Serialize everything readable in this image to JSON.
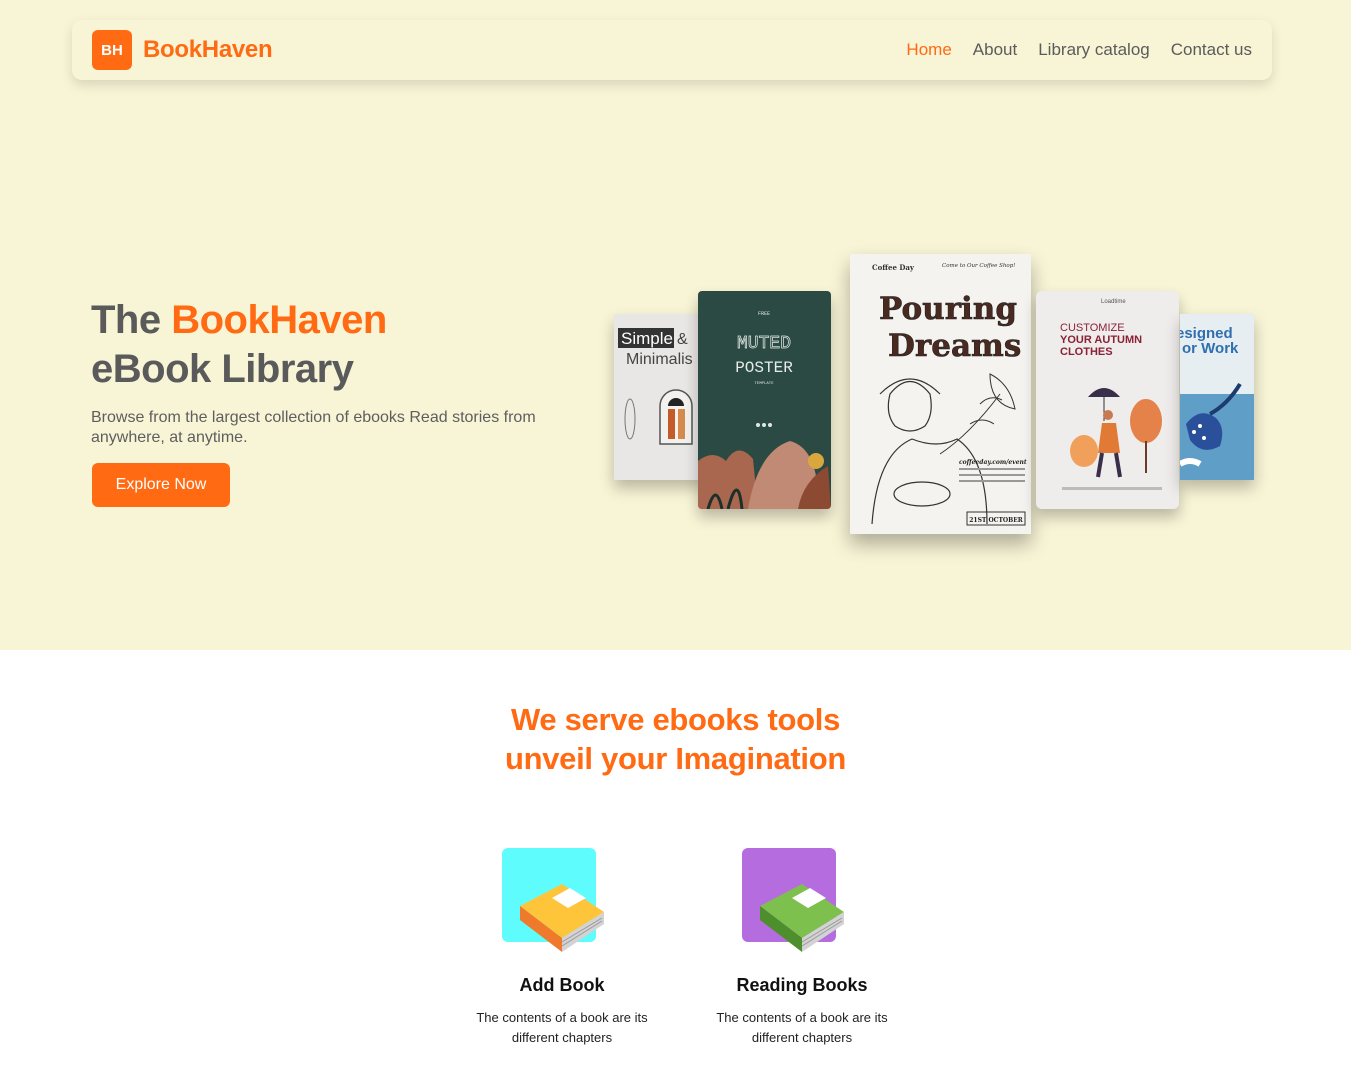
{
  "header": {
    "logo_text": "BH",
    "brand": "BookHaven",
    "nav": [
      {
        "label": "Home",
        "active": true
      },
      {
        "label": "About",
        "active": false
      },
      {
        "label": "Library catalog",
        "active": false
      },
      {
        "label": "Contact us",
        "active": false
      }
    ]
  },
  "hero": {
    "title_prefix": "The ",
    "title_accent": "BookHaven",
    "title_suffix": "eBook Library",
    "description": "Browse from the largest collection of ebooks Read stories from anywhere, at anytime.",
    "cta_label": "Explore Now",
    "covers": [
      {
        "line1": "Simple",
        "line2": "&",
        "line3": "Minimalis"
      },
      {
        "line1": "FREE",
        "line2": "MUTED",
        "line3": "POSTER",
        "line4": "TEMPLATE"
      },
      {
        "line1": "Coffee Day",
        "line2": "Come to Our Coffee Shop!",
        "line3": "Pouring",
        "line4": "Dreams",
        "line5": "coffeeday.com/event",
        "line6": "21ST OCTOBER"
      },
      {
        "line1": "Loadtime",
        "line2": "CUSTOMIZE",
        "line3": "YOUR AUTUMN",
        "line4": "CLOTHES"
      },
      {
        "line1": "esigned",
        "line2": "or Work"
      }
    ]
  },
  "features_section": {
    "title_line1": "We serve ebooks tools",
    "title_line2": "unveil your Imagination",
    "items": [
      {
        "title": "Add Book",
        "desc": "The contents of a book are its different chapters",
        "icon": "orange-book-icon",
        "bg": "#5efcfc"
      },
      {
        "title": "Reading Books",
        "desc": "The contents of a book are its different chapters",
        "icon": "green-book-icon",
        "bg": "#b56cdf"
      }
    ]
  },
  "colors": {
    "accent": "#ff6a13",
    "hero_bg": "#f8f4d6"
  }
}
